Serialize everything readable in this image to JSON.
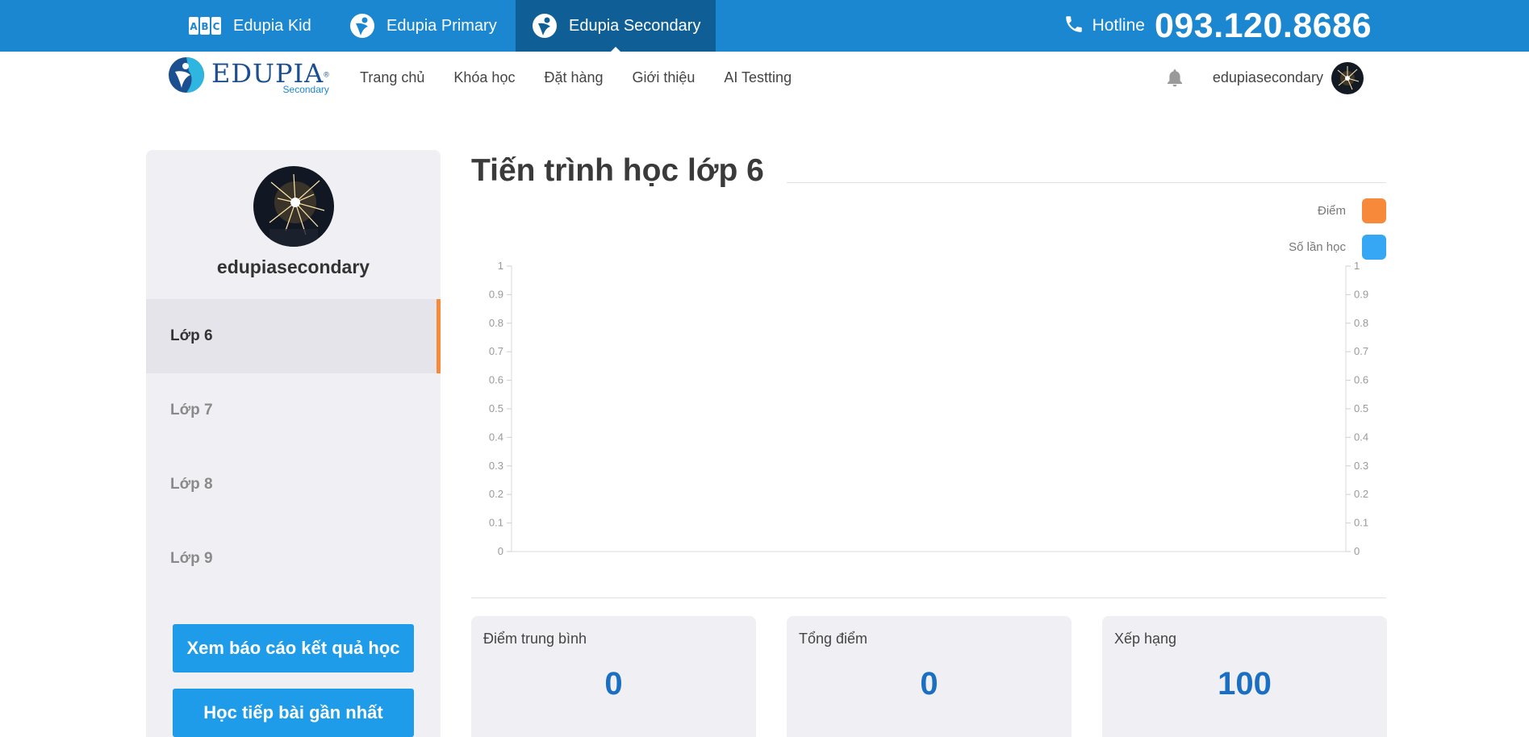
{
  "topbar": {
    "tabs": [
      {
        "label": "Edupia Kid"
      },
      {
        "label": "Edupia Primary"
      },
      {
        "label": "Edupia Secondary"
      }
    ],
    "hotline_label": "Hotline",
    "hotline_number": "093.120.8686"
  },
  "navbar": {
    "logo_text": "EDUPIA",
    "logo_sub": "Secondary",
    "links": [
      "Trang chủ",
      "Khóa học",
      "Đặt hàng",
      "Giới thiệu",
      "AI Testting"
    ],
    "username": "edupiasecondary"
  },
  "sidebar": {
    "profile_name": "edupiasecondary",
    "grades": [
      {
        "label": "Lớp 6",
        "active": true
      },
      {
        "label": "Lớp 7",
        "active": false
      },
      {
        "label": "Lớp 8",
        "active": false
      },
      {
        "label": "Lớp 9",
        "active": false
      }
    ],
    "report_button": "Xem báo cáo kết quả học",
    "continue_button": "Học tiếp bài gần nhất"
  },
  "main": {
    "title": "Tiến trình học lớp 6",
    "legend": [
      {
        "label": "Điểm",
        "color": "#f7893b"
      },
      {
        "label": "Số lần học",
        "color": "#36a7f5"
      }
    ],
    "stats": [
      {
        "label": "Điểm trung bình",
        "value": "0"
      },
      {
        "label": "Tổng điểm",
        "value": "0"
      },
      {
        "label": "Xếp hạng",
        "value": "100"
      }
    ]
  },
  "chart_data": {
    "type": "bar",
    "categories": [],
    "series": [
      {
        "name": "Điểm",
        "values": []
      },
      {
        "name": "Số lần học",
        "values": []
      }
    ],
    "ylim": [
      0,
      1
    ],
    "yticks": [
      "0",
      "0.1",
      "0.2",
      "0.3",
      "0.4",
      "0.5",
      "0.6",
      "0.7",
      "0.8",
      "0.9",
      "1"
    ],
    "y2ticks": [
      "0",
      "0.1",
      "0.2",
      "0.3",
      "0.4",
      "0.5",
      "0.6",
      "0.7",
      "0.8",
      "0.9",
      "1"
    ],
    "legend": "top-right"
  }
}
